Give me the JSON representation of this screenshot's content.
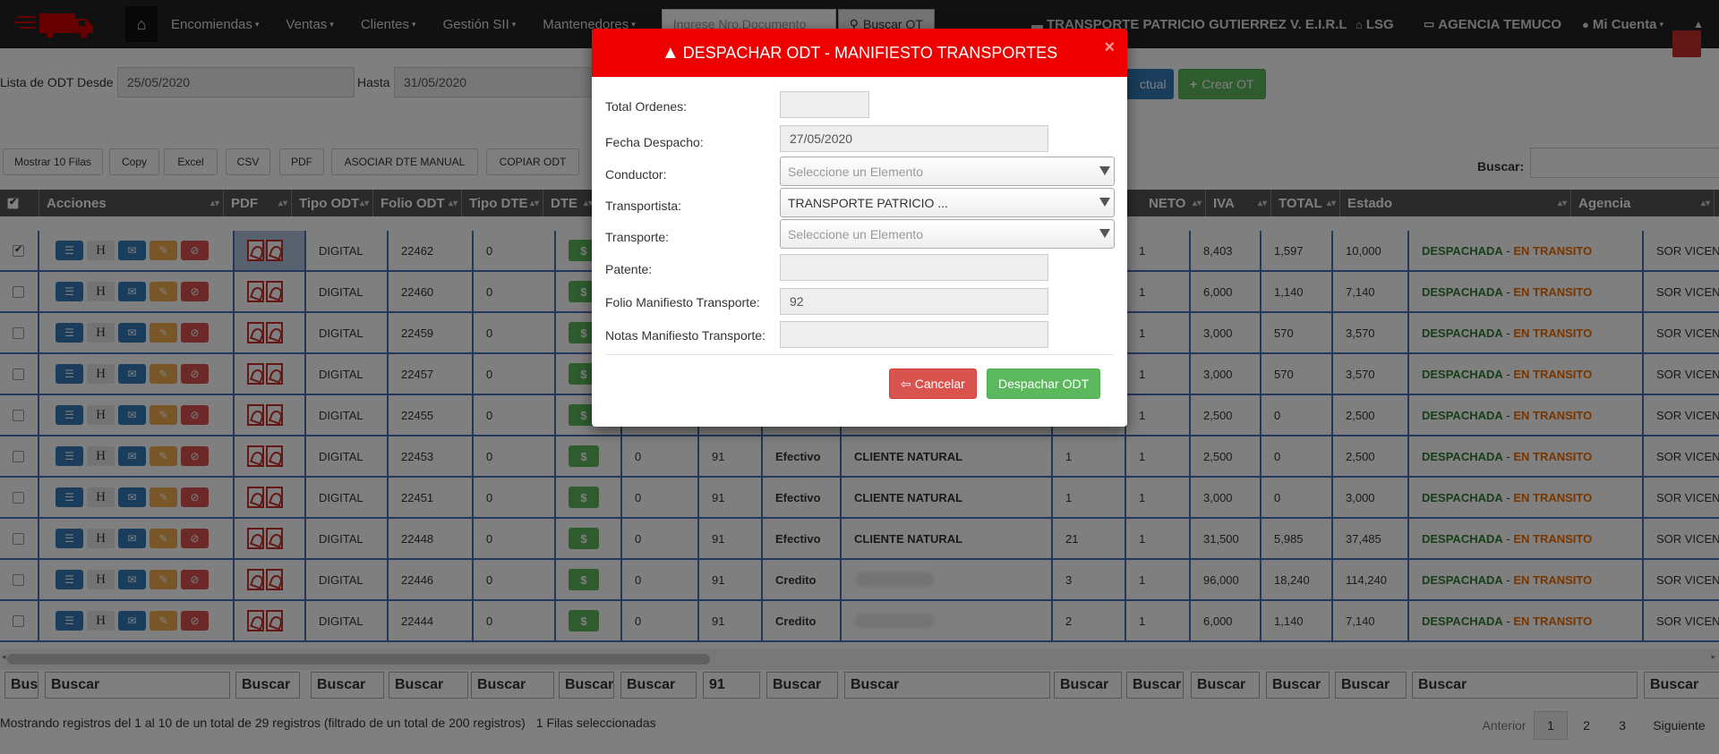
{
  "navbar": {
    "menus": [
      "Encomiendas",
      "Ventas",
      "Clientes",
      "Gestión SII",
      "Mantenedores"
    ],
    "search_placeholder": "Ingrese Nro.Documento",
    "search_button": "Buscar OT",
    "company": "TRANSPORTE PATRICIO GUTIERREZ V. E.I.R.L",
    "lsg": "LSG",
    "agency": "AGENCIA TEMUCO",
    "account": "Mi Cuenta"
  },
  "filters": {
    "from_label": "Lista de ODT Desde",
    "from_value": "25/05/2020",
    "to_label": "Hasta",
    "to_value": "31/05/2020",
    "actual_button": "ctual",
    "create_button": "Crear OT"
  },
  "toolbar": {
    "buttons": [
      "Mostrar 10 Filas",
      "Copy",
      "Excel",
      "CSV",
      "PDF",
      "ASOCIAR DTE MANUAL",
      "COPIAR ODT"
    ],
    "search_label": "Buscar:"
  },
  "table": {
    "headers": [
      "Acciones",
      "PDF",
      "Tipo ODT",
      "Folio ODT",
      "Tipo DTE",
      "DTE",
      "NETO",
      "IVA",
      "TOTAL",
      "Estado",
      "Agencia"
    ],
    "rows": [
      {
        "selected": true,
        "tipo": "DIGITAL",
        "folio": "22462",
        "tipo_dte": "0",
        "c1": "",
        "c2": "",
        "c3": "",
        "cliente": "",
        "bultos": "",
        "one": "1",
        "neto": "8,403",
        "iva": "1,597",
        "total": "10,000",
        "agencia": "SOR VICEN"
      },
      {
        "selected": false,
        "tipo": "DIGITAL",
        "folio": "22460",
        "tipo_dte": "0",
        "c1": "",
        "c2": "",
        "c3": "",
        "cliente": "",
        "bultos": "",
        "one": "1",
        "neto": "6,000",
        "iva": "1,140",
        "total": "7,140",
        "agencia": "SOR VICEN"
      },
      {
        "selected": false,
        "tipo": "DIGITAL",
        "folio": "22459",
        "tipo_dte": "0",
        "c1": "",
        "c2": "",
        "c3": "",
        "cliente": "",
        "bultos": "",
        "one": "1",
        "neto": "3,000",
        "iva": "570",
        "total": "3,570",
        "agencia": "SOR VICEN"
      },
      {
        "selected": false,
        "tipo": "DIGITAL",
        "folio": "22457",
        "tipo_dte": "0",
        "c1": "",
        "c2": "",
        "c3": "",
        "cliente": "",
        "bultos": "",
        "one": "1",
        "neto": "3,000",
        "iva": "570",
        "total": "3,570",
        "agencia": "SOR VICEN"
      },
      {
        "selected": false,
        "tipo": "DIGITAL",
        "folio": "22455",
        "tipo_dte": "0",
        "c1": "",
        "c2": "",
        "c3": "",
        "cliente": "",
        "bultos": "",
        "one": "1",
        "neto": "2,500",
        "iva": "0",
        "total": "2,500",
        "agencia": "SOR VICEN"
      },
      {
        "selected": false,
        "tipo": "DIGITAL",
        "folio": "22453",
        "tipo_dte": "0",
        "c1": "0",
        "c2": "91",
        "c3": "Efectivo",
        "cliente": "CLIENTE NATURAL",
        "bultos": "1",
        "one": "1",
        "neto": "2,500",
        "iva": "0",
        "total": "2,500",
        "agencia": "SOR VICEN"
      },
      {
        "selected": false,
        "tipo": "DIGITAL",
        "folio": "22451",
        "tipo_dte": "0",
        "c1": "0",
        "c2": "91",
        "c3": "Efectivo",
        "cliente": "CLIENTE NATURAL",
        "bultos": "1",
        "one": "1",
        "neto": "3,000",
        "iva": "0",
        "total": "3,000",
        "agencia": "SOR VICEN"
      },
      {
        "selected": false,
        "tipo": "DIGITAL",
        "folio": "22448",
        "tipo_dte": "0",
        "c1": "0",
        "c2": "91",
        "c3": "Efectivo",
        "cliente": "CLIENTE NATURAL",
        "bultos": "21",
        "one": "1",
        "neto": "31,500",
        "iva": "5,985",
        "total": "37,485",
        "agencia": "SOR VICEN"
      },
      {
        "selected": false,
        "tipo": "DIGITAL",
        "folio": "22446",
        "tipo_dte": "0",
        "c1": "0",
        "c2": "91",
        "c3": "Credito",
        "cliente": "",
        "blur": true,
        "bultos": "3",
        "one": "1",
        "neto": "96,000",
        "iva": "18,240",
        "total": "114,240",
        "agencia": "SOR VICEN"
      },
      {
        "selected": false,
        "tipo": "DIGITAL",
        "folio": "22444",
        "tipo_dte": "0",
        "c1": "0",
        "c2": "91",
        "c3": "Credito",
        "cliente": "",
        "blur": true,
        "bultos": "2",
        "one": "1",
        "neto": "6,000",
        "iva": "1,140",
        "total": "7,140",
        "agencia": "SOR VICEN"
      }
    ],
    "status_a": "DESPACHADA",
    "status_sep": " - ",
    "status_b": "EN TRANSITO",
    "footer_search": [
      "Bus",
      "Buscar",
      "Buscar",
      "Buscar",
      "Buscar",
      "Buscar",
      "Buscar",
      "Buscar",
      "91",
      "Buscar",
      "Buscar",
      "Buscar",
      "Buscar",
      "Buscar",
      "Buscar",
      "Buscar",
      "Buscar",
      "Buscar"
    ]
  },
  "footer": {
    "info": "Mostrando registros del 1 al 10 de un total de 29 registros (filtrado de un total de 200 registros)",
    "selected": "1 Filas seleccionadas",
    "prev": "Anterior",
    "pages": [
      "1",
      "2",
      "3"
    ],
    "next": "Siguiente"
  },
  "modal": {
    "title": "DESPACHAR ODT - MANIFIESTO TRANSPORTES",
    "close": "×",
    "fields": {
      "total_label": "Total Ordenes:",
      "total_value": "",
      "fecha_label": "Fecha Despacho:",
      "fecha_value": "27/05/2020",
      "conductor_label": "Conductor:",
      "conductor_value": "Seleccione un Elemento",
      "transportista_label": "Transportista:",
      "transportista_value": "TRANSPORTE PATRICIO ...",
      "transporte_label": "Transporte:",
      "transporte_value": "Seleccione un Elemento",
      "patente_label": "Patente:",
      "patente_value": "",
      "folio_label": "Folio Manifiesto Transporte:",
      "folio_value": "92",
      "notas_label": "Notas Manifiesto Transporte:",
      "notas_value": ""
    },
    "cancel": "Cancelar",
    "submit": "Despachar ODT"
  },
  "colors": {
    "modal_header": "#ee0000",
    "status_green": "#2e7d32",
    "status_orange": "#ef6c00",
    "row_border": "#4a6fb5"
  }
}
